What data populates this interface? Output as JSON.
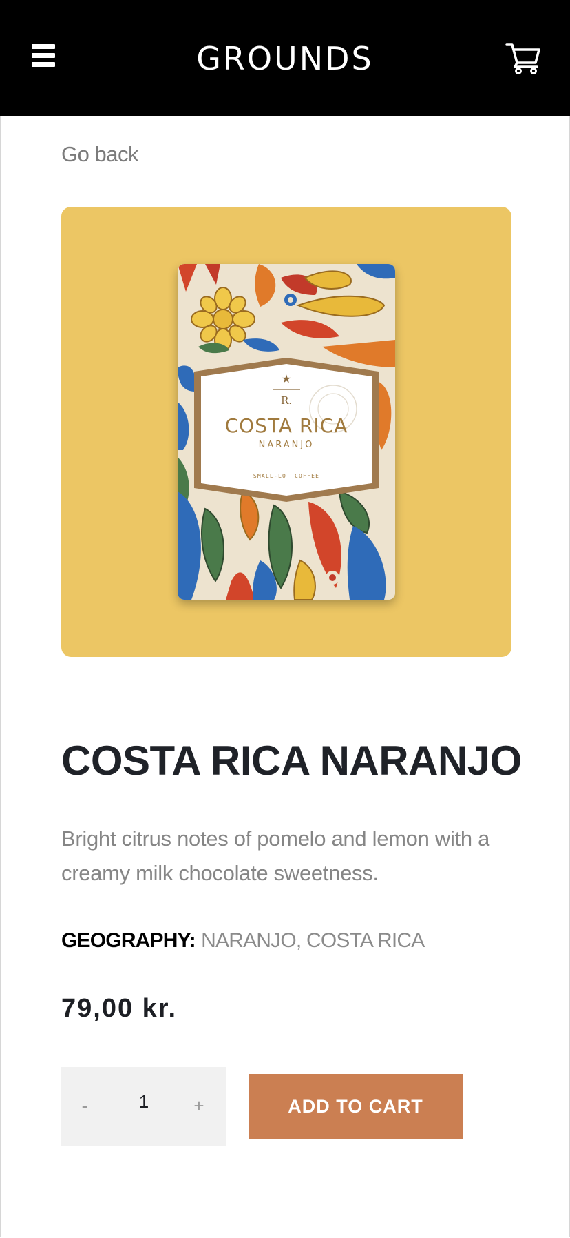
{
  "header": {
    "brand": "GROUNDS",
    "menu_icon": "hamburger-menu-icon",
    "cart_icon": "shopping-cart-icon",
    "background": "#000000"
  },
  "nav": {
    "back_label": "Go back"
  },
  "product": {
    "image_bg": "#ecc664",
    "package": {
      "name": "COSTA RICA",
      "subname": "NARANJO",
      "tagline": "SMALL-LOT COFFEE",
      "mark": "R."
    },
    "title": "COSTA RICA NARANJO",
    "description": "Bright citrus notes of pomelo and lemon with a creamy milk chocolate sweetness.",
    "geography_label": "GEOGRAPHY:",
    "geography_value": "NARANJO, COSTA RICA",
    "price": "79,00 kr."
  },
  "quantity": {
    "minus": "-",
    "value": "1",
    "plus": "+"
  },
  "actions": {
    "add_to_cart": "ADD TO CART",
    "add_to_cart_color": "#cb7f52"
  }
}
